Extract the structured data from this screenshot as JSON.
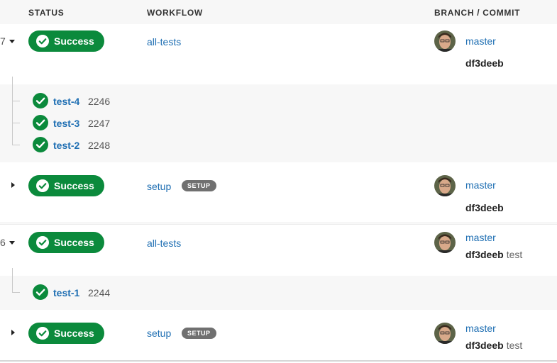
{
  "header": {
    "status": "STATUS",
    "workflow": "WORKFLOW",
    "branch_commit": "BRANCH / COMMIT"
  },
  "colors": {
    "success": "#0b8a3c",
    "link": "#1f6fb3",
    "badge": "#707070",
    "row_alt": "#f7f7f7"
  },
  "groups": [
    {
      "pipeline_num_fragment": "7",
      "workflows": [
        {
          "status": "Success",
          "workflow": "all-tests",
          "badge": "",
          "branch": "master",
          "commit_sha": "df3deeb",
          "commit_msg": "",
          "jobs": [
            {
              "name": "test-4",
              "number": "2246"
            },
            {
              "name": "test-3",
              "number": "2247"
            },
            {
              "name": "test-2",
              "number": "2248"
            }
          ]
        },
        {
          "status": "Success",
          "workflow": "setup",
          "badge": "SETUP",
          "branch": "master",
          "commit_sha": "df3deeb",
          "commit_msg": ""
        }
      ]
    },
    {
      "pipeline_num_fragment": "6",
      "workflows": [
        {
          "status": "Success",
          "workflow": "all-tests",
          "badge": "",
          "branch": "master",
          "commit_sha": "df3deeb",
          "commit_msg": "test",
          "jobs": [
            {
              "name": "test-1",
              "number": "2244"
            }
          ]
        },
        {
          "status": "Success",
          "workflow": "setup",
          "badge": "SETUP",
          "branch": "master",
          "commit_sha": "df3deeb",
          "commit_msg": "test"
        }
      ]
    }
  ]
}
